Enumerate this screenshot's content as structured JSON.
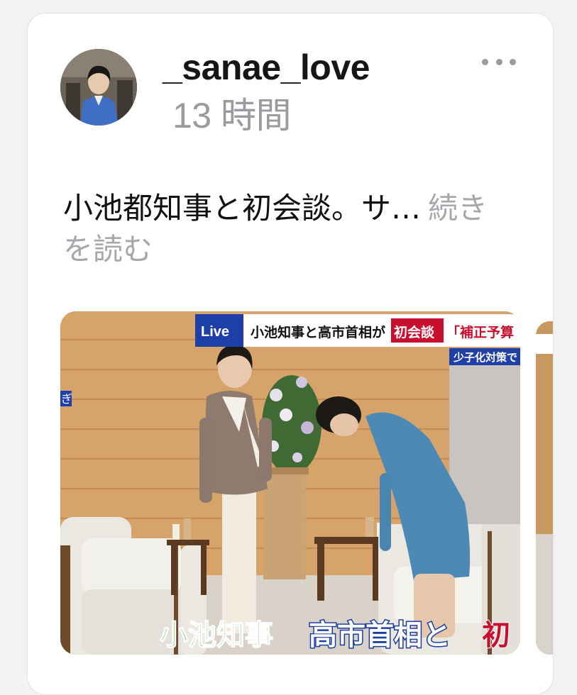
{
  "post": {
    "username": "_sanae_love",
    "timestamp": "13 時間",
    "text": "小池都知事と初会談。サ…",
    "read_more": "続きを読む"
  },
  "media": {
    "live_label": "Live",
    "headline_prefix": "小池知事と高市首相が",
    "headline_highlight": "初会談",
    "headline_suffix": "「補正予算",
    "sub_headline": "少子化対策で",
    "left_edge_text": "ぎ",
    "caption_left": "小池知事",
    "caption_right_white": "高市首相と",
    "caption_right_red": "初"
  },
  "icons": {
    "more": "ellipsis-icon",
    "avatar": "profile-photo"
  },
  "colors": {
    "live_blue": "#1e3fa8",
    "highlight_red": "#c8102e",
    "caption_green": "#2fa83a",
    "caption_blue": "#1d3ea0",
    "muted": "#9a9aa0"
  }
}
